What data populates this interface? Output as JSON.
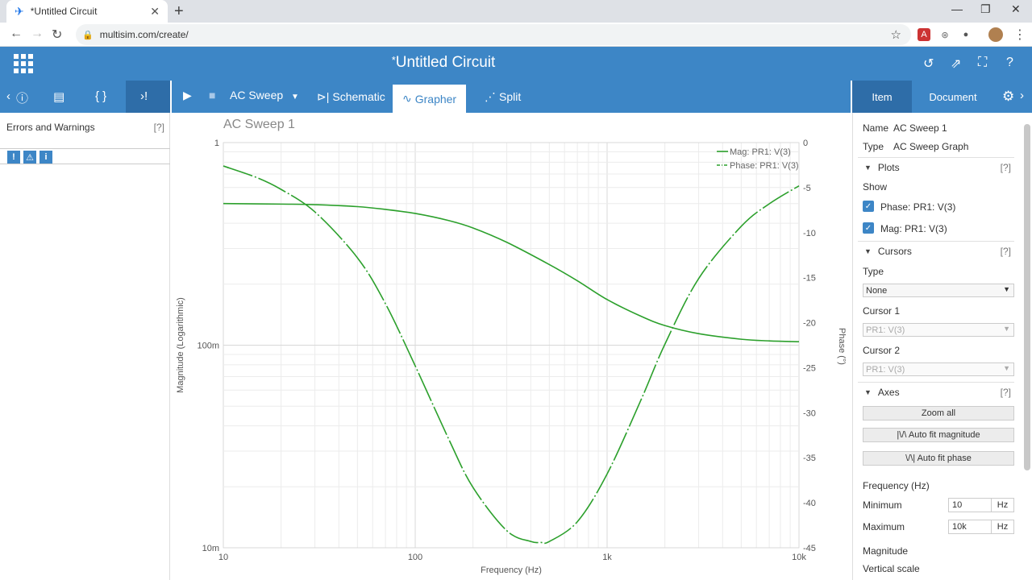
{
  "browser": {
    "tab_title": "*Untitled Circuit",
    "url": "multisim.com/create/"
  },
  "header": {
    "title_star": "*",
    "title": "Untitled Circuit"
  },
  "toolbar": {
    "analysis": "AC Sweep",
    "tabs": [
      "Schematic",
      "Grapher",
      "Split"
    ]
  },
  "left_panel": {
    "title": "Errors and Warnings",
    "help": "[?]"
  },
  "right_panel": {
    "tabs": [
      "Item",
      "Document"
    ],
    "name_label": "Name",
    "name_value": "AC Sweep 1",
    "type_label": "Type",
    "type_value": "AC Sweep Graph",
    "plots_label": "Plots",
    "help": "[?]",
    "show_label": "Show",
    "plot_items": [
      "Phase: PR1: V(3)",
      "Mag: PR1: V(3)"
    ],
    "cursors_label": "Cursors",
    "cursor_type_label": "Type",
    "cursor_type_value": "None",
    "cursor1_label": "Cursor 1",
    "cursor1_value": "PR1: V(3)",
    "cursor2_label": "Cursor 2",
    "cursor2_value": "PR1: V(3)",
    "axes_label": "Axes",
    "zoom_all": "Zoom all",
    "auto_mag": "|\\/\\   Auto fit magnitude",
    "auto_phase": "\\/\\|   Auto fit phase",
    "freq_label": "Frequency (Hz)",
    "min_label": "Minimum",
    "min_value": "10",
    "min_unit": "Hz",
    "max_label": "Maximum",
    "max_value": "10k",
    "max_unit": "Hz",
    "magnitude_label": "Magnitude",
    "vscale_label": "Vertical scale"
  },
  "chart_data": {
    "type": "line",
    "title": "AC Sweep 1",
    "xlabel": "Frequency (Hz)",
    "ylabel": "Magnitude (Logarithmic)",
    "y2label": "Phase (°)",
    "x_scale": "log",
    "xlim": [
      10,
      10000
    ],
    "x_ticks": [
      "10",
      "100",
      "1k",
      "10k"
    ],
    "y_scale": "log",
    "ylim": [
      0.01,
      1
    ],
    "y_ticks": [
      "1",
      "100m",
      "10m"
    ],
    "y2lim": [
      -45,
      0
    ],
    "y2_ticks": [
      "0",
      "-5",
      "-10",
      "-15",
      "-20",
      "-25",
      "-30",
      "-35",
      "-40",
      "-45"
    ],
    "legend_position": "top-right",
    "grid": true,
    "series": [
      {
        "name": "Mag: PR1: V(3)",
        "axis": "left",
        "style": "solid",
        "x": [
          10,
          20,
          30,
          50,
          70,
          100,
          150,
          200,
          300,
          500,
          700,
          1000,
          1500,
          2000,
          3000,
          5000,
          7000,
          10000
        ],
        "y": [
          0.5,
          0.497,
          0.494,
          0.483,
          0.468,
          0.447,
          0.412,
          0.379,
          0.322,
          0.25,
          0.208,
          0.168,
          0.139,
          0.125,
          0.114,
          0.107,
          0.105,
          0.104
        ]
      },
      {
        "name": "Phase: PR1: V(3)",
        "axis": "right",
        "style": "dash-dot",
        "x": [
          10,
          15,
          20,
          30,
          50,
          70,
          100,
          150,
          200,
          300,
          400,
          450,
          500,
          700,
          1000,
          1500,
          2000,
          3000,
          5000,
          7000,
          10000
        ],
        "y": [
          -2.6,
          -3.9,
          -5.2,
          -7.7,
          -12.8,
          -17.9,
          -24.8,
          -33.0,
          -38.3,
          -43.1,
          -44.3,
          -44.4,
          -44.3,
          -42.1,
          -36.8,
          -28.6,
          -22.4,
          -15.1,
          -9.3,
          -6.8,
          -4.8
        ]
      }
    ]
  },
  "colors": {
    "accent": "#3d86c6",
    "series": "#2ca02c"
  }
}
